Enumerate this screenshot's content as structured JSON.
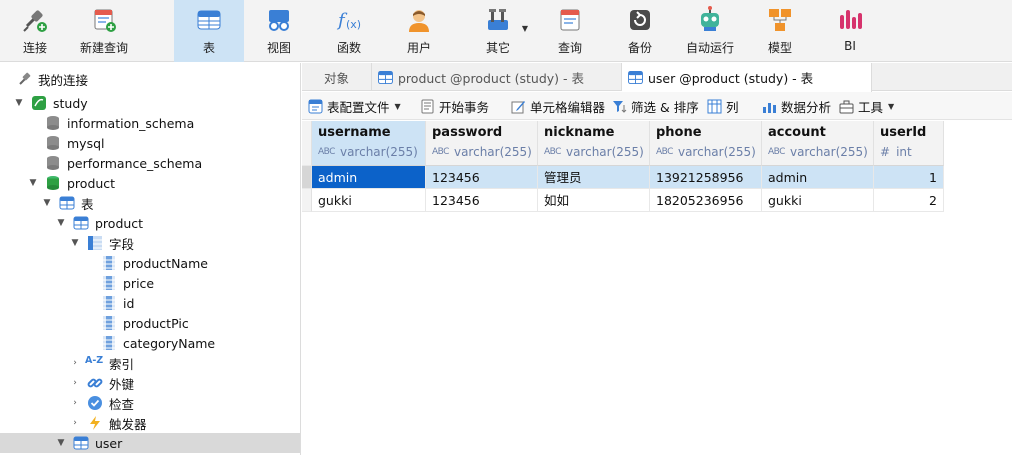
{
  "toolbar": {
    "items": [
      {
        "label": "连接",
        "icon": "connect-icon"
      },
      {
        "label": "新建查询",
        "icon": "new-query-icon"
      },
      {
        "label": "表",
        "icon": "table-icon"
      },
      {
        "label": "视图",
        "icon": "view-icon"
      },
      {
        "label": "函数",
        "icon": "function-icon"
      },
      {
        "label": "用户",
        "icon": "user-icon"
      },
      {
        "label": "其它",
        "icon": "tools-icon"
      },
      {
        "label": "查询",
        "icon": "query-icon"
      },
      {
        "label": "备份",
        "icon": "backup-icon"
      },
      {
        "label": "自动运行",
        "icon": "robot-icon"
      },
      {
        "label": "模型",
        "icon": "model-icon"
      },
      {
        "label": "BI",
        "icon": "bi-icon"
      }
    ],
    "active": "表"
  },
  "sidebar": {
    "root_label": "我的连接",
    "items": [
      {
        "label": "study"
      },
      {
        "label": "information_schema"
      },
      {
        "label": "mysql"
      },
      {
        "label": "performance_schema"
      },
      {
        "label": "product"
      },
      {
        "label": "表"
      },
      {
        "label": "product"
      },
      {
        "label": "字段"
      },
      {
        "label": "productName"
      },
      {
        "label": "price"
      },
      {
        "label": "id"
      },
      {
        "label": "productPic"
      },
      {
        "label": "categoryName"
      },
      {
        "label": "索引"
      },
      {
        "label": "外键"
      },
      {
        "label": "检查"
      },
      {
        "label": "触发器"
      },
      {
        "label": "user"
      }
    ],
    "index_badge": "A-Z"
  },
  "tabs": {
    "objects": "对象",
    "tab1": "product @product (study) - 表",
    "tab2": "user @product (study) - 表"
  },
  "subbar": {
    "table_config": "表配置文件",
    "begin_tx": "开始事务",
    "cell_editor": "单元格编辑器",
    "filter_sort": "筛选 & 排序",
    "columns": "列",
    "data_analysis": "数据分析",
    "tools": "工具"
  },
  "grid": {
    "columns": [
      {
        "name": "username",
        "type": "varchar(255)",
        "type_kind": "abc"
      },
      {
        "name": "password",
        "type": "varchar(255)",
        "type_kind": "abc"
      },
      {
        "name": "nickname",
        "type": "varchar(255)",
        "type_kind": "abc"
      },
      {
        "name": "phone",
        "type": "varchar(255)",
        "type_kind": "abc"
      },
      {
        "name": "account",
        "type": "varchar(255)",
        "type_kind": "abc"
      },
      {
        "name": "userId",
        "type": "int",
        "type_kind": "hash"
      }
    ],
    "type_prefix_abc": "ABC",
    "type_prefix_hash": "#",
    "rows": [
      [
        "admin",
        "123456",
        "管理员",
        "13921258956",
        "admin",
        "1"
      ],
      [
        "gukki",
        "123456",
        "如如",
        "18205236956",
        "gukki",
        "2"
      ]
    ]
  },
  "colors": {
    "accent_blue": "#0c62c9",
    "selection": "#cde3f5",
    "toolbar_bg": "#f3f3f3"
  }
}
